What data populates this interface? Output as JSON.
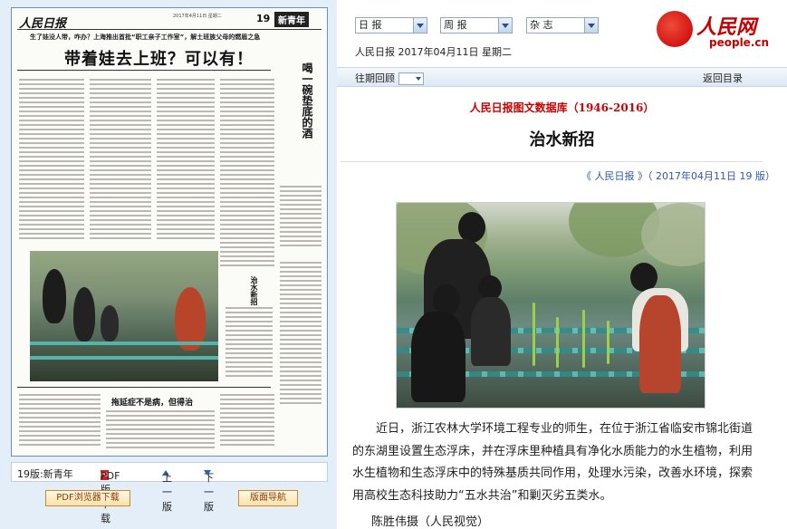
{
  "newspaper": {
    "logo": "人民日报",
    "page_number": "19",
    "section": "新青年",
    "meta": "2017年4月11日 星期二",
    "kicker": "生了娃没人带，咋办？上海推出首批“职工亲子工作室”，解土班族父母的燃眉之急",
    "headline": "带着娃去上班？可以有！",
    "side_title": "喝一碗垫底的酒",
    "side_photo_title": "治水新招",
    "sub_headline": "拖延症不是病，但得治"
  },
  "left_nav": {
    "page_label": "19版:新青年",
    "pdf_download": "PDF版下载",
    "prev_page": "上一版",
    "next_page": "下一版",
    "pdf_browser_download": "PDF浏览器下载",
    "page_navigation": "版面导航"
  },
  "topbar": {
    "select_paper": "日 报",
    "select_weekly": "周 报",
    "select_magazine": "杂 志",
    "date_line": "人民日报 2017年04月11日 星期二"
  },
  "logo": {
    "cn": "人民网",
    "en": "people.cn"
  },
  "subnav": {
    "back_issues": "往期回顾",
    "back_to_toc": "返回目录"
  },
  "article": {
    "database_title": "人民日报图文数据库（1946-2016）",
    "title": "治水新招",
    "source": "《 人民日报 》（ 2017年04月11日   19 版）",
    "body": "近日，浙江农林大学环境工程专业的师生，在位于浙江省临安市锦北街道的东湖里设置生态浮床，并在浮床里种植具有净化水质能力的水生植物，利用水生植物和生态浮床中的特殊基质共同作用，处理水污染，改善水环境，探索用高校生态科技助力“五水共治”和剿灭劣五类水。",
    "credit": "陈胜伟摄（人民视觉）"
  },
  "colors": {
    "accent_red": "#cc0000",
    "link_blue": "#2c5aa8",
    "pane_blue": "#e4eef8"
  },
  "icons": [
    "pdf-icon",
    "arrow-up-icon",
    "arrow-down-icon",
    "dropdown-icon",
    "people-logo-icon"
  ]
}
